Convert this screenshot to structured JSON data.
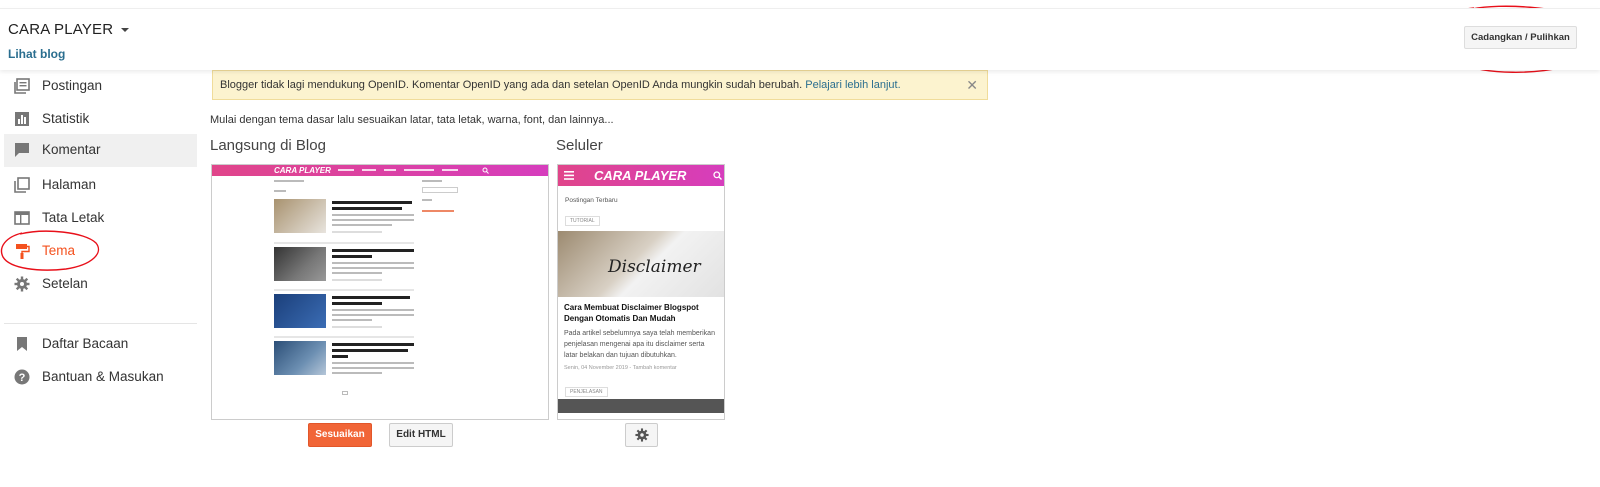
{
  "header": {
    "blog_title": "CARA PLAYER",
    "view_blog": "Lihat blog",
    "backup_button": "Cadangkan / Pulihkan"
  },
  "sidebar": {
    "items": [
      {
        "label": "Postingan",
        "icon": "posts-icon"
      },
      {
        "label": "Statistik",
        "icon": "stats-icon"
      },
      {
        "label": "Komentar",
        "icon": "comment-icon"
      },
      {
        "label": "Halaman",
        "icon": "pages-icon"
      },
      {
        "label": "Tata Letak",
        "icon": "layout-icon"
      },
      {
        "label": "Tema",
        "icon": "paint-roller-icon"
      },
      {
        "label": "Setelan",
        "icon": "gear-icon"
      },
      {
        "label": "Daftar Bacaan",
        "icon": "bookmark-icon"
      },
      {
        "label": "Bantuan & Masukan",
        "icon": "help-icon"
      }
    ]
  },
  "notice": {
    "text": "Blogger tidak lagi mendukung OpenID. Komentar OpenID yang ada dan setelan OpenID Anda mungkin sudah berubah.",
    "link": "Pelajari lebih lanjut.",
    "close": "✕"
  },
  "main": {
    "intro": "Mulai dengan tema dasar lalu sesuaikan latar, tata letak, warna, font, dan lainnya...",
    "live_title": "Langsung di Blog",
    "mobile_title": "Seluler",
    "customize_button": "Sesuaikan",
    "edit_html_button": "Edit HTML",
    "mobile_settings_icon": "gear-icon"
  },
  "mobile_preview": {
    "brand": "CARA PLAYER",
    "recent_label": "Postingan Terbaru",
    "tag1": "TUTORIAL",
    "image_text": "Disclaimer",
    "post_title": "Cara Membuat Disclaimer Blogspot Dengan Otomatis Dan Mudah",
    "post_excerpt": "Pada artikel sebelumnya saya telah memberikan penjelasan mengenai apa itu disclaimer serta latar belakan dan tujuan dibutuhkan.",
    "post_meta": "Senin, 04 November 2019 - Tambah komentar",
    "tag2": "PENJELASAN"
  },
  "desktop_preview": {
    "brand": "CARA PLAYER"
  },
  "colors": {
    "accent_orange": "#f16537",
    "active_red": "#f4511e",
    "link_blue": "#2a6e8f",
    "brand_pink": "#e0458a",
    "annotation_red": "#e8101a"
  }
}
